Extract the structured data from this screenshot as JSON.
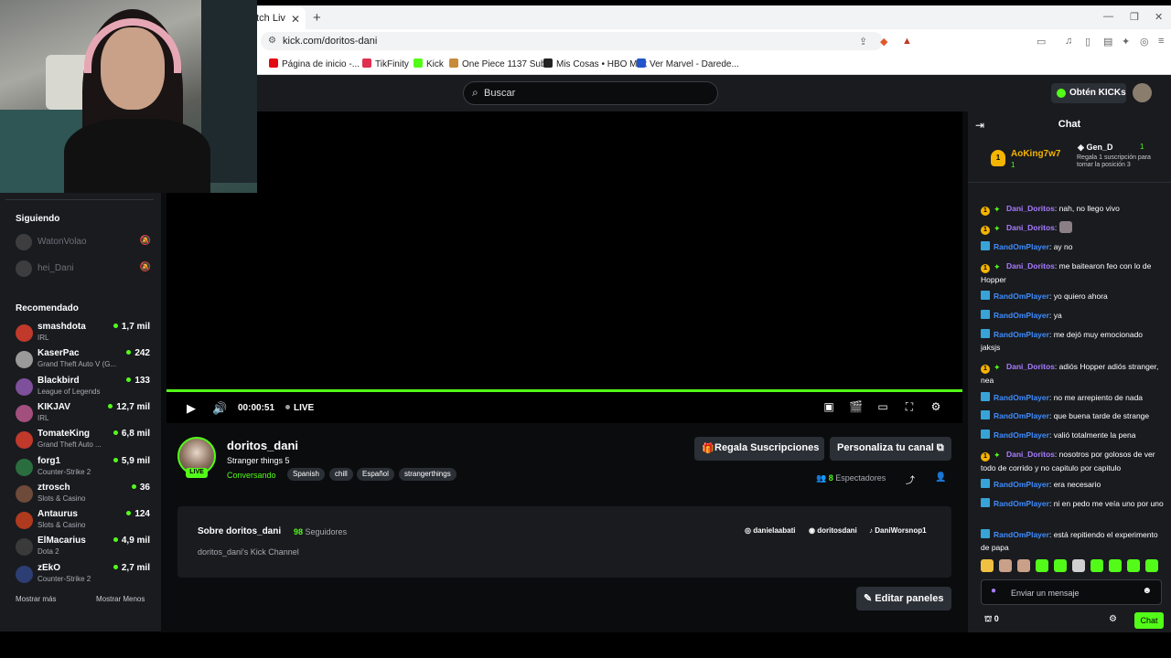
{
  "browser": {
    "tab_label": "atch Liv",
    "url": "kick.com/doritos-dani",
    "bookmarks": [
      {
        "label": "Página de inicio -...",
        "color": "#e50914"
      },
      {
        "label": "TikFinity",
        "color": "#e03050"
      },
      {
        "label": "Kick",
        "color": "#53fc18"
      },
      {
        "label": "One Piece 1137 Sub...",
        "color": "#c88b3a"
      },
      {
        "label": "Mis Cosas • HBO Max",
        "color": "#222222"
      },
      {
        "label": "Ver Marvel - Darede...",
        "color": "#2255cc"
      }
    ]
  },
  "header": {
    "search_placeholder": "Buscar",
    "get_kicks_label": "Obtén KICKs"
  },
  "sidebar": {
    "following_heading": "Siguiendo",
    "following": [
      {
        "name": "WatonVolao"
      },
      {
        "name": "hei_Dani"
      }
    ],
    "recommended_heading": "Recomendado",
    "recommended": [
      {
        "name": "smashdota",
        "category": "IRL",
        "viewers": "1,7 mil",
        "color": "#c0392b"
      },
      {
        "name": "KaserPac",
        "category": "Grand Theft Auto V (G...",
        "viewers": "242",
        "color": "#9a9a9a"
      },
      {
        "name": "Blackbird",
        "category": "League of Legends",
        "viewers": "133",
        "color": "#7e4f9a"
      },
      {
        "name": "KIKJAV",
        "category": "IRL",
        "viewers": "12,7 mil",
        "color": "#a34f7e"
      },
      {
        "name": "TomateKing",
        "category": "Grand Theft Auto ...",
        "viewers": "6,8 mil",
        "color": "#c0392b"
      },
      {
        "name": "forg1",
        "category": "Counter-Strike 2",
        "viewers": "5,9 mil",
        "color": "#2a6e3f"
      },
      {
        "name": "ztrosch",
        "category": "Slots & Casino",
        "viewers": "36",
        "color": "#6e4a3a"
      },
      {
        "name": "Antaurus",
        "category": "Slots & Casino",
        "viewers": "124",
        "color": "#b03a1e"
      },
      {
        "name": "ElMacarius",
        "category": "Dota 2",
        "viewers": "4,9 mil",
        "color": "#3a3a3a"
      },
      {
        "name": "zEkO",
        "category": "Counter-Strike 2",
        "viewers": "2,7 mil",
        "color": "#2c3e73"
      }
    ],
    "show_more": "Mostrar más",
    "show_less": "Mostrar Menos"
  },
  "player": {
    "time": "00:00:51",
    "live_label": "LIVE"
  },
  "channel": {
    "name": "doritos_dani",
    "live_badge": "LIVE",
    "stream_title": "Stranger things 5",
    "category": "Conversando",
    "tags": [
      "Spanish",
      "chill",
      "Español",
      "strangerthings"
    ],
    "gift_subs_label": "Regala Suscripciones",
    "customize_label": "Personaliza tu canal",
    "viewers_count": "8",
    "viewers_label": "Espectadores"
  },
  "about": {
    "title": "Sobre doritos_dani",
    "followers_count": "98",
    "followers_label": "Seguidores",
    "description": "doritos_dani's Kick Channel",
    "socials": [
      "danielaabati",
      "doritosdani",
      "DaniWorsnop1"
    ],
    "edit_panels_label": "Editar paneles"
  },
  "chat": {
    "title": "Chat",
    "pinned_user": "AoKing7w7",
    "pinned_rank": "1",
    "pinned_count": "1",
    "gifter_name": "Gen_D",
    "gifter_count": "1",
    "gifter_desc": "Regala 1 suscripción para tomar la posición 3",
    "messages": [
      {
        "user": "Dani_Doritos",
        "kind": "dani",
        "text": "nah, no llego vivo"
      },
      {
        "user": "Dani_Doritos",
        "kind": "dani",
        "text": ""
      },
      {
        "user": "RandOmPlayer",
        "kind": "rand",
        "text": "ay no"
      },
      {
        "user": "Dani_Doritos",
        "kind": "dani",
        "text": "me baitearon feo con lo de Hopper"
      },
      {
        "user": "RandOmPlayer",
        "kind": "rand",
        "text": "yo quiero ahora"
      },
      {
        "user": "RandOmPlayer",
        "kind": "rand",
        "text": "ya"
      },
      {
        "user": "RandOmPlayer",
        "kind": "rand",
        "text": "me dejó muy emocionado jaksjs"
      },
      {
        "user": "Dani_Doritos",
        "kind": "dani",
        "text": "adiós Hopper adiós stranger, nea"
      },
      {
        "user": "RandOmPlayer",
        "kind": "rand",
        "text": "no me arrepiento de nada"
      },
      {
        "user": "RandOmPlayer",
        "kind": "rand",
        "text": "que buena tarde de strange"
      },
      {
        "user": "RandOmPlayer",
        "kind": "rand",
        "text": "valió totalmente la pena"
      },
      {
        "user": "Dani_Doritos",
        "kind": "dani",
        "text": "nosotros por golosos de ver todo de corrido y no capitulo por capitulo"
      },
      {
        "user": "RandOmPlayer",
        "kind": "rand",
        "text": "era necesario"
      },
      {
        "user": "RandOmPlayer",
        "kind": "rand",
        "text": "ni en pedo me veía uno por uno"
      },
      {
        "user": "RandOmPlayer",
        "kind": "rand",
        "text": "está repitiendo el experimento de papa"
      }
    ],
    "input_placeholder": "Enviar un mensaje",
    "kicks_count": "0",
    "send_label": "Chat"
  },
  "colors": {
    "accent": "#53fc18",
    "dani_user": "#a97cff",
    "rand_user": "#3f8cff",
    "gold": "#f5b400"
  }
}
